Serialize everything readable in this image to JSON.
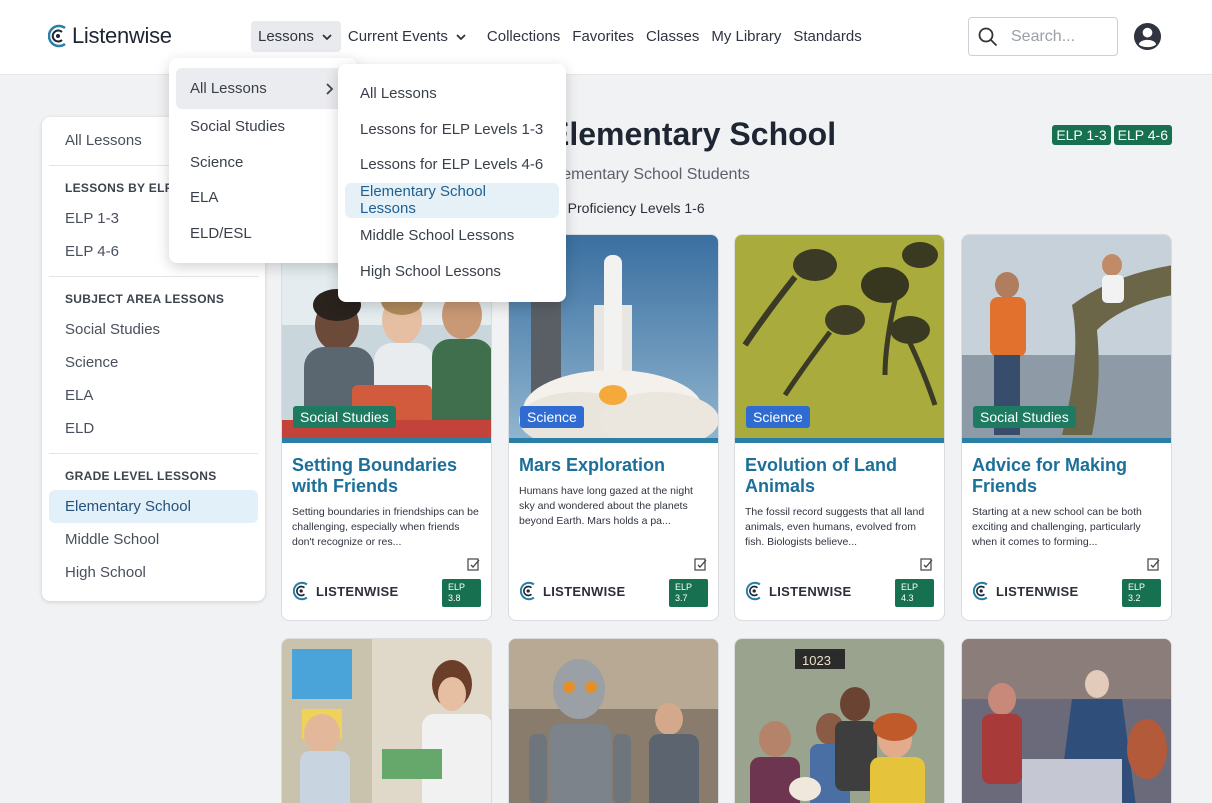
{
  "header": {
    "logo_text": "Listenwise",
    "nav": [
      {
        "label": "Lessons"
      },
      {
        "label": "Current Events"
      },
      {
        "label": "Collections"
      },
      {
        "label": "Favorites"
      },
      {
        "label": "Classes"
      },
      {
        "label": "My Library"
      },
      {
        "label": "Standards"
      }
    ],
    "search_placeholder": "Search..."
  },
  "sidebar": {
    "all_lessons": "All Lessons",
    "elp_heading": "LESSONS BY ELP",
    "elp_items": [
      "ELP 1-3",
      "ELP 4-6"
    ],
    "subject_heading": "SUBJECT AREA LESSONS",
    "subject_items": [
      "Social Studies",
      "Science",
      "ELA",
      "ELD"
    ],
    "grade_heading": "GRADE LEVEL LESSONS",
    "grade_items": [
      "Elementary School",
      "Middle School",
      "High School"
    ]
  },
  "main": {
    "title": "Elementary School",
    "subtitle": "Elementary School Students",
    "proficiency": "e Proficiency Levels 1-6",
    "elp_tags": [
      "ELP 1-3",
      "ELP 4-6"
    ]
  },
  "lessons_menu": {
    "items": [
      "All Lessons",
      "Social Studies",
      "Science",
      "ELA",
      "ELD/ESL"
    ],
    "submenu": [
      "All Lessons",
      "Lessons for ELP Levels 1-3",
      "Lessons for ELP Levels 4-6",
      "Elementary School Lessons",
      "Middle School Lessons",
      "High School Lessons"
    ]
  },
  "cards": [
    {
      "subject": "Social Studies",
      "title": "Setting Boundaries with Friends",
      "desc": "Setting boundaries in friendships can be challenging, especially when friends don't recognize or res...",
      "brand": "LISTENWISE",
      "elp_label": "ELP",
      "elp_value": "3.8"
    },
    {
      "subject": "Science",
      "title": "Mars Exploration",
      "desc": "Humans have long gazed at the night sky and wondered about the planets beyond Earth. Mars holds a pa...",
      "brand": "LISTENWISE",
      "elp_label": "ELP",
      "elp_value": "3.7"
    },
    {
      "subject": "Science",
      "title": "Evolution of Land Animals",
      "desc": "The fossil record suggests that all land animals, even humans, evolved from fish. Biologists believe...",
      "brand": "LISTENWISE",
      "elp_label": "ELP",
      "elp_value": "4.3"
    },
    {
      "subject": "Social Studies",
      "title": "Advice for Making Friends",
      "desc": "Starting at a new school can be both exciting and challenging, particularly when it comes to forming...",
      "brand": "LISTENWISE",
      "elp_label": "ELP",
      "elp_value": "3.2"
    }
  ],
  "house_number": "1023",
  "colors": {
    "accent": "#1c6f98",
    "elp_green": "#17704f",
    "social_studies": "#1e7a60",
    "science": "#2f6bd1",
    "stripe": "#2a7fa6"
  }
}
